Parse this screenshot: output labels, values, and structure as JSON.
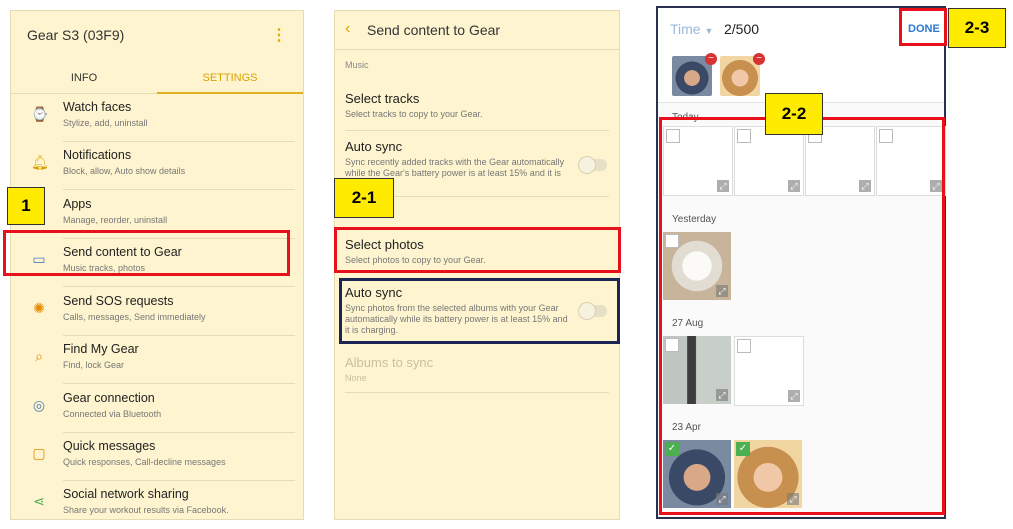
{
  "panel1": {
    "title": "Gear S3 (03F9)",
    "tabs": [
      "INFO",
      "SETTINGS"
    ],
    "items": [
      {
        "title": "Watch faces",
        "subtitle": "Stylize, add, uninstall",
        "icon": "watch-icon"
      },
      {
        "title": "Notifications",
        "subtitle": "Block, allow, Auto show details",
        "icon": "bell-icon"
      },
      {
        "title": "Apps",
        "subtitle": "Manage, reorder, uninstall",
        "icon": "apps-icon"
      },
      {
        "title": "Send content to Gear",
        "subtitle": "Music tracks, photos",
        "icon": "folder-icon"
      },
      {
        "title": "Send SOS requests",
        "subtitle": "Calls, messages, Send immediately",
        "icon": "sos-icon"
      },
      {
        "title": "Find My Gear",
        "subtitle": "Find, lock Gear",
        "icon": "find-icon"
      },
      {
        "title": "Gear connection",
        "subtitle": "Connected via Bluetooth",
        "icon": "connection-icon"
      },
      {
        "title": "Quick messages",
        "subtitle": "Quick responses, Call-decline messages",
        "icon": "message-icon"
      },
      {
        "title": "Social network sharing",
        "subtitle": "Share your workout results via Facebook.",
        "icon": "share-icon"
      }
    ]
  },
  "panel2": {
    "title": "Send content to Gear",
    "section": "Music",
    "rows": [
      {
        "title": "Select tracks",
        "subtitle": "Select tracks to copy to your Gear."
      },
      {
        "title": "Auto sync",
        "subtitle": "Sync recently added tracks with the Gear automatically while the Gear's battery power is at least 15% and it is charging."
      },
      {
        "title": "Select photos",
        "subtitle": "Select photos to copy to your Gear."
      },
      {
        "title": "Auto sync",
        "subtitle": "Sync photos from the selected albums with your Gear automatically while its battery power is at least 15% and it is charging."
      },
      {
        "title": "Albums to sync",
        "subtitle": "None"
      }
    ]
  },
  "panel3": {
    "filter": "Time",
    "counter": "2/500",
    "done": "DONE",
    "days": [
      "Today",
      "Yesterday",
      "27 Aug",
      "23 Apr"
    ]
  },
  "callouts": {
    "c1": "1",
    "c21": "2-1",
    "c22": "2-2",
    "c23": "2-3"
  },
  "colors": {
    "accent": "#d9a200",
    "highlight": "#e8101a",
    "label": "#ffeb00",
    "navy": "#1c2454"
  }
}
